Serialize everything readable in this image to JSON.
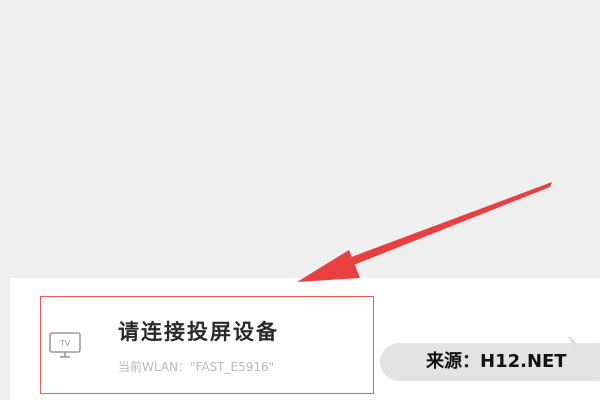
{
  "cast": {
    "title": "请连接投屏设备",
    "wlan_label": "当前WLAN：",
    "wlan_name": "\"FAST_E5916\""
  },
  "icons": {
    "device": "tv-icon",
    "chevron": "chevron-right-icon",
    "arrow": "red-arrow-annotation"
  },
  "watermark": {
    "text": "来源：H12.NET"
  },
  "colors": {
    "background": "#efefef",
    "card": "#ffffff",
    "annotation_red": "#e8403f",
    "title_text": "#2a2a2a",
    "subtitle_text": "#b8b8b8"
  }
}
